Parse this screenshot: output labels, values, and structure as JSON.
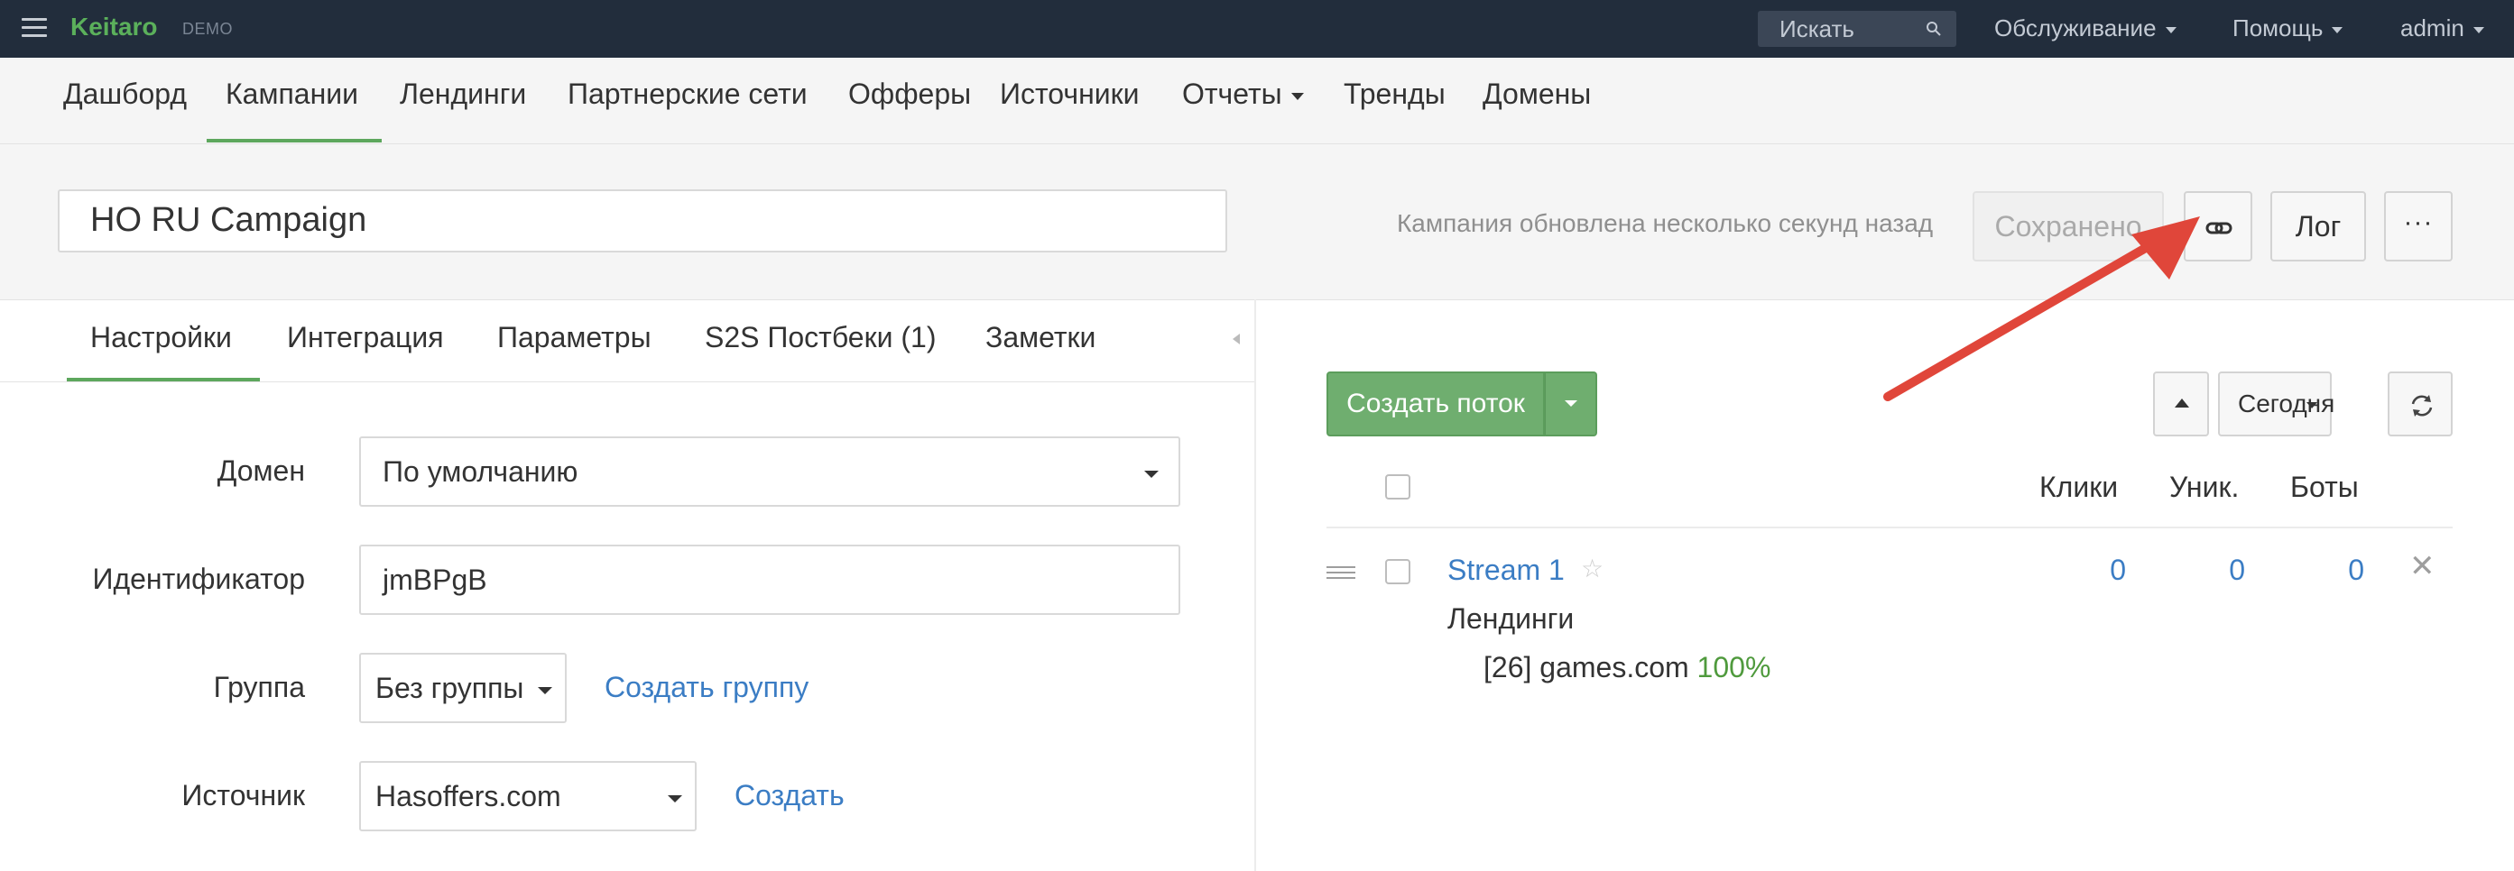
{
  "topbar": {
    "brand": "Keitaro",
    "brand_sub": "DEMO",
    "search_placeholder": "Искать",
    "menu": [
      "Обслуживание",
      "Помощь",
      "admin"
    ]
  },
  "mainnav": {
    "items": [
      "Дашборд",
      "Кампании",
      "Лендинги",
      "Партнерские сети",
      "Офферы",
      "Источники",
      "Отчеты",
      "Тренды",
      "Домены"
    ],
    "active": "Кампании"
  },
  "campaign": {
    "name": "HO RU Campaign",
    "status_text": "Кампания обновлена несколько секунд назад",
    "saved_label": "Сохранено",
    "log_label": "Лог",
    "more_label": "···"
  },
  "tabs": [
    "Настройки",
    "Интеграция",
    "Параметры",
    "S2S Постбеки (1)",
    "Заметки"
  ],
  "form": {
    "domain_label": "Домен",
    "domain_value": "По умолчанию",
    "id_label": "Идентификатор",
    "id_value": "jmBPgB",
    "group_label": "Группа",
    "group_value": "Без группы",
    "create_group": "Создать группу",
    "source_label": "Источник",
    "source_value": "Hasoffers.com",
    "create_source": "Создать"
  },
  "streams": {
    "create_label": "Создать поток",
    "date_label": "Сегодня",
    "headers": [
      "Клики",
      "Уник.",
      "Боты"
    ],
    "rows": [
      {
        "name": "Stream 1",
        "clicks": "0",
        "unique": "0",
        "bots": "0",
        "section_label": "Лендинги",
        "lander": "[26] games.com",
        "lander_pct": "100%"
      }
    ]
  },
  "colors": {
    "topbar": "#222d3c",
    "accent_green": "#5da75d",
    "link_blue": "#3b7dc4",
    "annotation_arrow": "#e0463a"
  }
}
